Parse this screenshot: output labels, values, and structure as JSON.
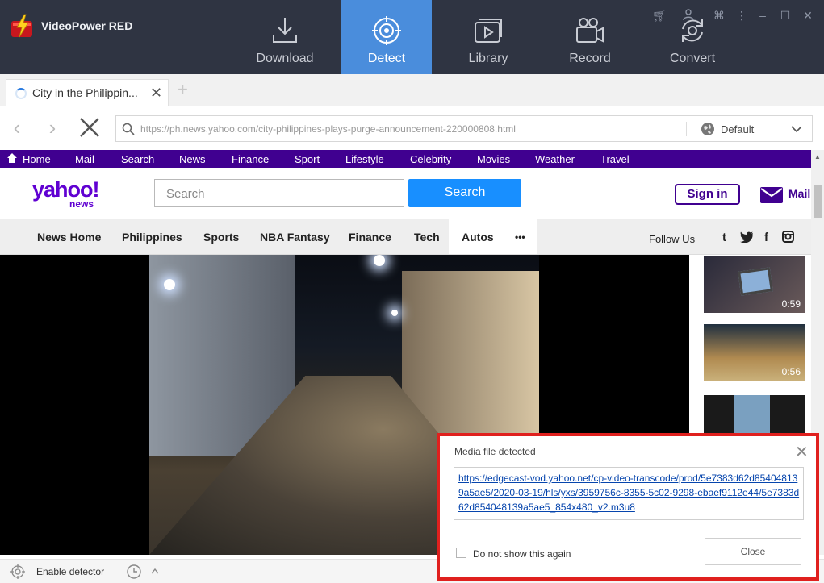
{
  "app": {
    "title": "VideoPower RED",
    "tabs": [
      {
        "label": "Download",
        "icon": "download-icon"
      },
      {
        "label": "Detect",
        "icon": "target-icon",
        "active": true
      },
      {
        "label": "Library",
        "icon": "library-icon"
      },
      {
        "label": "Record",
        "icon": "camera-icon"
      },
      {
        "label": "Convert",
        "icon": "convert-icon"
      }
    ],
    "window_controls": [
      "cart-icon",
      "user-icon",
      "command-icon",
      "more-icon",
      "minimize-icon",
      "maximize-icon",
      "close-icon"
    ],
    "accent_color": "#4a8ddc"
  },
  "browser": {
    "tab_title": "City in the Philippin...",
    "url": "https://ph.news.yahoo.com/city-philippines-plays-purge-announcement-220000808.html",
    "search_engine": "Default"
  },
  "yahoo": {
    "top_links": [
      "Home",
      "Mail",
      "Search",
      "News",
      "Finance",
      "Sport",
      "Lifestyle",
      "Celebrity",
      "Movies",
      "Weather",
      "Travel"
    ],
    "logo": "yahoo!",
    "logo_sub": "news",
    "search_placeholder": "Search",
    "search_button": "Search",
    "sign_in": "Sign in",
    "mail": "Mail",
    "nav": [
      "News Home",
      "Philippines",
      "Sports",
      "NBA Fantasy",
      "Finance",
      "Tech",
      "Autos",
      "•••"
    ],
    "follow_us": "Follow Us",
    "social": [
      "t",
      "twitter-icon",
      "f",
      "instagram-icon"
    ],
    "purple": "#400090"
  },
  "thumbnails": [
    {
      "duration": "0:59"
    },
    {
      "duration": "0:56"
    },
    {
      "duration": ""
    }
  ],
  "status": {
    "detector_label": "Enable detector"
  },
  "popup": {
    "title": "Media file detected",
    "link": "https://edgecast-vod.yahoo.net/cp-video-transcode/prod/5e7383d62d854048139a5ae5/2020-03-19/hls/yxs/3959756c-8355-5c02-9298-ebaef9112e44/5e7383d62d854048139a5ae5_854x480_v2.m3u8",
    "checkbox_label": "Do not show this again",
    "close_button": "Close",
    "border_color": "#e0201e"
  }
}
